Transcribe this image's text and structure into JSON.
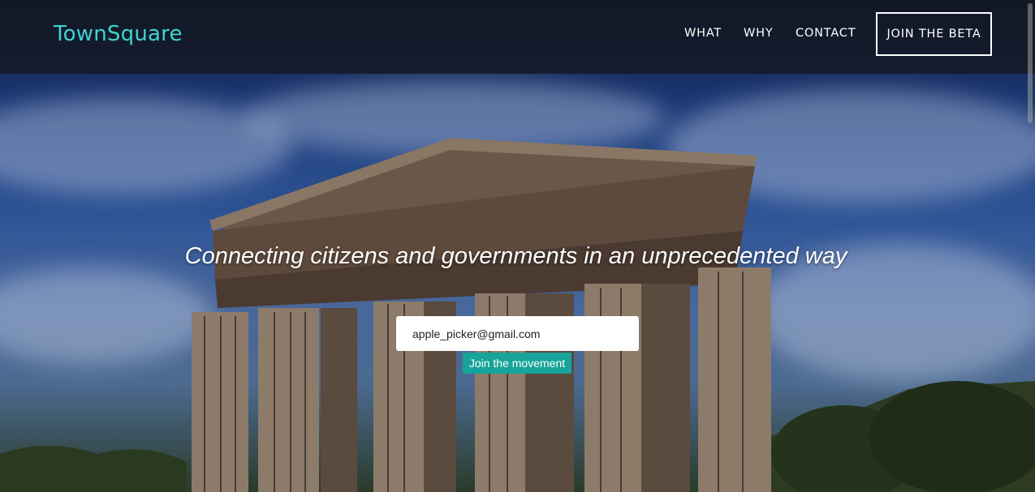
{
  "brand": {
    "name": "TownSquare",
    "color": "#3fd3d0"
  },
  "nav": {
    "links": [
      "WHAT",
      "WHY",
      "CONTACT"
    ],
    "cta_label": "JOIN THE BETA"
  },
  "hero": {
    "tagline": "Connecting citizens and governments in an unprecedented way",
    "background_image": "greek-temple-photo"
  },
  "signup": {
    "email_value": "apple_picker@gmail.com",
    "button_label": "Join the movement",
    "button_color": "#17a39a"
  }
}
